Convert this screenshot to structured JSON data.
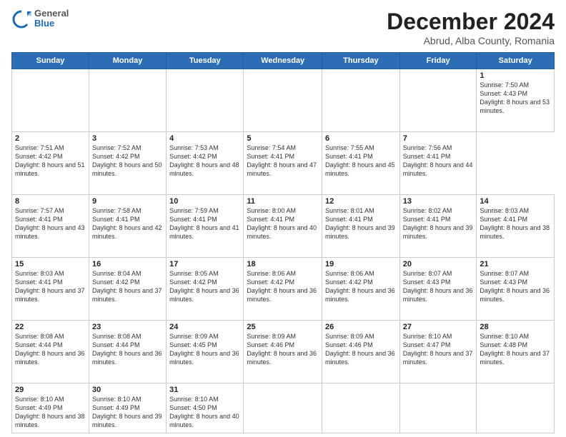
{
  "header": {
    "logo_general": "General",
    "logo_blue": "Blue",
    "month_title": "December 2024",
    "location": "Abrud, Alba County, Romania"
  },
  "calendar": {
    "days_of_week": [
      "Sunday",
      "Monday",
      "Tuesday",
      "Wednesday",
      "Thursday",
      "Friday",
      "Saturday"
    ],
    "weeks": [
      [
        null,
        null,
        null,
        null,
        null,
        null,
        {
          "day": "1",
          "sunrise": "7:50 AM",
          "sunset": "4:43 PM",
          "daylight": "8 hours and 53 minutes."
        }
      ],
      [
        {
          "day": "2",
          "sunrise": "7:51 AM",
          "sunset": "4:42 PM",
          "daylight": "8 hours and 51 minutes."
        },
        {
          "day": "3",
          "sunrise": "7:52 AM",
          "sunset": "4:42 PM",
          "daylight": "8 hours and 50 minutes."
        },
        {
          "day": "4",
          "sunrise": "7:53 AM",
          "sunset": "4:42 PM",
          "daylight": "8 hours and 48 minutes."
        },
        {
          "day": "5",
          "sunrise": "7:54 AM",
          "sunset": "4:41 PM",
          "daylight": "8 hours and 47 minutes."
        },
        {
          "day": "6",
          "sunrise": "7:55 AM",
          "sunset": "4:41 PM",
          "daylight": "8 hours and 45 minutes."
        },
        {
          "day": "7",
          "sunrise": "7:56 AM",
          "sunset": "4:41 PM",
          "daylight": "8 hours and 44 minutes."
        }
      ],
      [
        {
          "day": "8",
          "sunrise": "7:57 AM",
          "sunset": "4:41 PM",
          "daylight": "8 hours and 43 minutes."
        },
        {
          "day": "9",
          "sunrise": "7:58 AM",
          "sunset": "4:41 PM",
          "daylight": "8 hours and 42 minutes."
        },
        {
          "day": "10",
          "sunrise": "7:59 AM",
          "sunset": "4:41 PM",
          "daylight": "8 hours and 41 minutes."
        },
        {
          "day": "11",
          "sunrise": "8:00 AM",
          "sunset": "4:41 PM",
          "daylight": "8 hours and 40 minutes."
        },
        {
          "day": "12",
          "sunrise": "8:01 AM",
          "sunset": "4:41 PM",
          "daylight": "8 hours and 39 minutes."
        },
        {
          "day": "13",
          "sunrise": "8:02 AM",
          "sunset": "4:41 PM",
          "daylight": "8 hours and 39 minutes."
        },
        {
          "day": "14",
          "sunrise": "8:03 AM",
          "sunset": "4:41 PM",
          "daylight": "8 hours and 38 minutes."
        }
      ],
      [
        {
          "day": "15",
          "sunrise": "8:03 AM",
          "sunset": "4:41 PM",
          "daylight": "8 hours and 37 minutes."
        },
        {
          "day": "16",
          "sunrise": "8:04 AM",
          "sunset": "4:42 PM",
          "daylight": "8 hours and 37 minutes."
        },
        {
          "day": "17",
          "sunrise": "8:05 AM",
          "sunset": "4:42 PM",
          "daylight": "8 hours and 36 minutes."
        },
        {
          "day": "18",
          "sunrise": "8:06 AM",
          "sunset": "4:42 PM",
          "daylight": "8 hours and 36 minutes."
        },
        {
          "day": "19",
          "sunrise": "8:06 AM",
          "sunset": "4:42 PM",
          "daylight": "8 hours and 36 minutes."
        },
        {
          "day": "20",
          "sunrise": "8:07 AM",
          "sunset": "4:43 PM",
          "daylight": "8 hours and 36 minutes."
        },
        {
          "day": "21",
          "sunrise": "8:07 AM",
          "sunset": "4:43 PM",
          "daylight": "8 hours and 36 minutes."
        }
      ],
      [
        {
          "day": "22",
          "sunrise": "8:08 AM",
          "sunset": "4:44 PM",
          "daylight": "8 hours and 36 minutes."
        },
        {
          "day": "23",
          "sunrise": "8:08 AM",
          "sunset": "4:44 PM",
          "daylight": "8 hours and 36 minutes."
        },
        {
          "day": "24",
          "sunrise": "8:09 AM",
          "sunset": "4:45 PM",
          "daylight": "8 hours and 36 minutes."
        },
        {
          "day": "25",
          "sunrise": "8:09 AM",
          "sunset": "4:46 PM",
          "daylight": "8 hours and 36 minutes."
        },
        {
          "day": "26",
          "sunrise": "8:09 AM",
          "sunset": "4:46 PM",
          "daylight": "8 hours and 36 minutes."
        },
        {
          "day": "27",
          "sunrise": "8:10 AM",
          "sunset": "4:47 PM",
          "daylight": "8 hours and 37 minutes."
        },
        {
          "day": "28",
          "sunrise": "8:10 AM",
          "sunset": "4:48 PM",
          "daylight": "8 hours and 37 minutes."
        }
      ],
      [
        {
          "day": "29",
          "sunrise": "8:10 AM",
          "sunset": "4:49 PM",
          "daylight": "8 hours and 38 minutes."
        },
        {
          "day": "30",
          "sunrise": "8:10 AM",
          "sunset": "4:49 PM",
          "daylight": "8 hours and 39 minutes."
        },
        {
          "day": "31",
          "sunrise": "8:10 AM",
          "sunset": "4:50 PM",
          "daylight": "8 hours and 40 minutes."
        },
        null,
        null,
        null,
        null
      ]
    ]
  }
}
